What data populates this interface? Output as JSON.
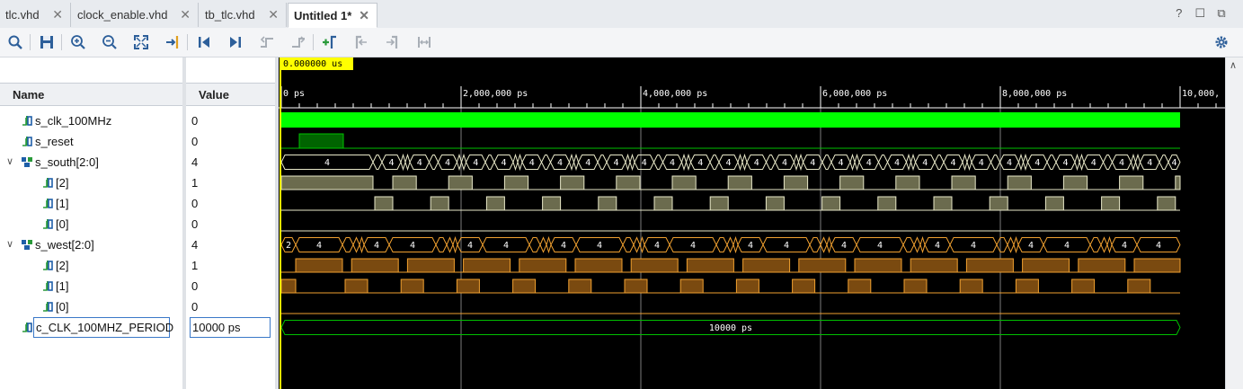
{
  "tabs": [
    {
      "label": "tlc.vhd",
      "close": "✕"
    },
    {
      "label": "clock_enable.vhd",
      "close": "✕"
    },
    {
      "label": "tb_tlc.vhd",
      "close": "✕"
    },
    {
      "label": "Untitled 1*",
      "close": "✕"
    }
  ],
  "window_controls": {
    "help": "?",
    "restore": "☐",
    "maximize": "⧉"
  },
  "toolbar": {
    "icons": [
      "search-icon",
      "save-icon",
      "zoom-in-icon",
      "zoom-out-icon",
      "zoom-fit-icon",
      "go-to-cursor-icon",
      "go-to-time-zero-icon",
      "go-to-last-time-icon",
      "previous-transition-icon",
      "next-transition-icon",
      "add-marker-icon",
      "previous-marker-icon",
      "next-marker-icon",
      "swap-cursors-icon",
      "settings-gear-icon"
    ]
  },
  "columns": {
    "name": "Name",
    "value": "Value"
  },
  "signals": [
    {
      "name": "s_clk_100MHz",
      "value": "0",
      "type": "bit",
      "expander": ""
    },
    {
      "name": "s_reset",
      "value": "0",
      "type": "bit",
      "expander": ""
    },
    {
      "name": "s_south[2:0]",
      "value": "4",
      "type": "bus",
      "expander": "∨"
    },
    {
      "name": "[2]",
      "value": "1",
      "type": "bit",
      "expander": ""
    },
    {
      "name": "[1]",
      "value": "0",
      "type": "bit",
      "expander": ""
    },
    {
      "name": "[0]",
      "value": "0",
      "type": "bit",
      "expander": ""
    },
    {
      "name": "s_west[2:0]",
      "value": "4",
      "type": "bus",
      "expander": "∨"
    },
    {
      "name": "[2]",
      "value": "1",
      "type": "bit",
      "expander": ""
    },
    {
      "name": "[1]",
      "value": "0",
      "type": "bit",
      "expander": ""
    },
    {
      "name": "[0]",
      "value": "0",
      "type": "bit",
      "expander": ""
    },
    {
      "name": "c_CLK_100MHZ_PERIOD",
      "value": "10000 ps",
      "type": "const",
      "expander": ""
    }
  ],
  "wave": {
    "cursor_time": "0.000000 us",
    "time_labels": [
      "0 ps",
      "2,000,000 ps",
      "4,000,000 ps",
      "6,000,000 ps",
      "8,000,000 ps",
      "10,000,"
    ],
    "bus_labels": {
      "a": "4",
      "b": "2"
    },
    "const_label": "10000 ps",
    "colors": {
      "clock": "#00ff00",
      "bit": "#00c000",
      "south": "#e8e8c8",
      "south_fill": "#6b6b4e",
      "west": "#f0a030",
      "west_fill": "#7a4a10",
      "cursor": "#ffff00",
      "grid": "#7d7d7d",
      "ruler": "#ffffff"
    }
  }
}
